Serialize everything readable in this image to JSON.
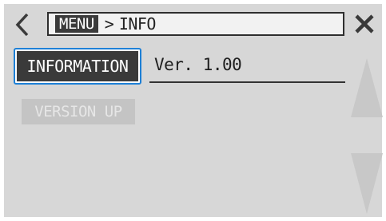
{
  "header": {
    "back_icon": "chevron-left-icon",
    "menu_label": "MENU",
    "separator": ">",
    "current_label": "INFO",
    "close_icon": "close-icon"
  },
  "info": {
    "button_label": "INFORMATION",
    "version": "Ver. 1.00"
  },
  "version_up": {
    "label": "VERSION UP",
    "enabled": false
  },
  "scroll": {
    "up_icon": "triangle-up-icon",
    "down_icon": "triangle-down-icon"
  },
  "colors": {
    "background": "#d7d7d7",
    "accent": "#1e80d6",
    "button_dark": "#3a3a3a",
    "disabled": "#c4c4c4"
  }
}
